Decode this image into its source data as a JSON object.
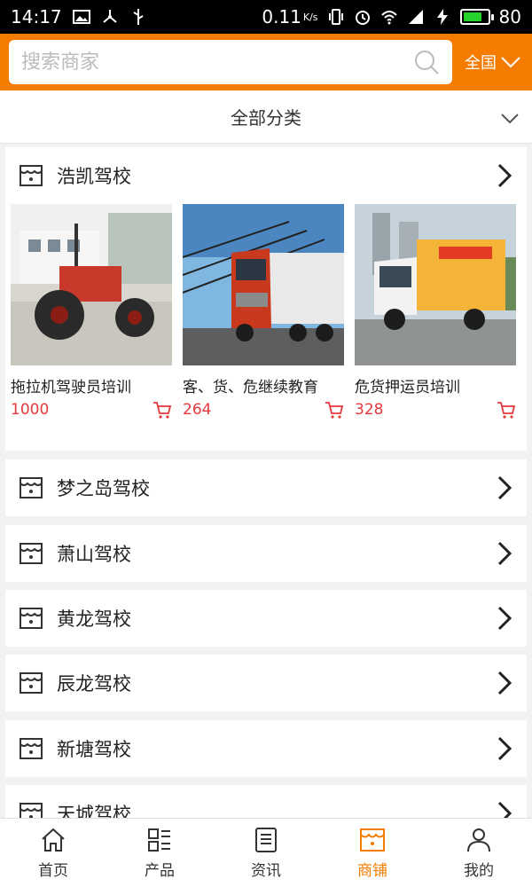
{
  "statusbar": {
    "time": "14:17",
    "speed": "0.11",
    "speed_unit": "K/s",
    "battery": "80",
    "battery_level": 0.8
  },
  "search": {
    "placeholder": "搜索商家"
  },
  "region": {
    "label": "全国"
  },
  "category": {
    "label": "全部分类"
  },
  "shops": [
    {
      "name": "浩凯驾校"
    },
    {
      "name": "梦之岛驾校"
    },
    {
      "name": "萧山驾校"
    },
    {
      "name": "黄龙驾校"
    },
    {
      "name": "辰龙驾校"
    },
    {
      "name": "新塘驾校"
    },
    {
      "name": "天城驾校"
    }
  ],
  "products": [
    {
      "name": "拖拉机驾驶员培训",
      "price": "1000"
    },
    {
      "name": "客、货、危继续教育",
      "price": "264"
    },
    {
      "name": "危货押运员培训",
      "price": "328"
    }
  ],
  "nav": [
    {
      "label": "首页",
      "icon": "home-icon"
    },
    {
      "label": "产品",
      "icon": "grid-icon"
    },
    {
      "label": "资讯",
      "icon": "news-icon"
    },
    {
      "label": "商铺",
      "icon": "store-icon",
      "active": true
    },
    {
      "label": "我的",
      "icon": "user-icon"
    }
  ],
  "colors": {
    "accent": "#f57c00",
    "price": "#e4393c"
  }
}
